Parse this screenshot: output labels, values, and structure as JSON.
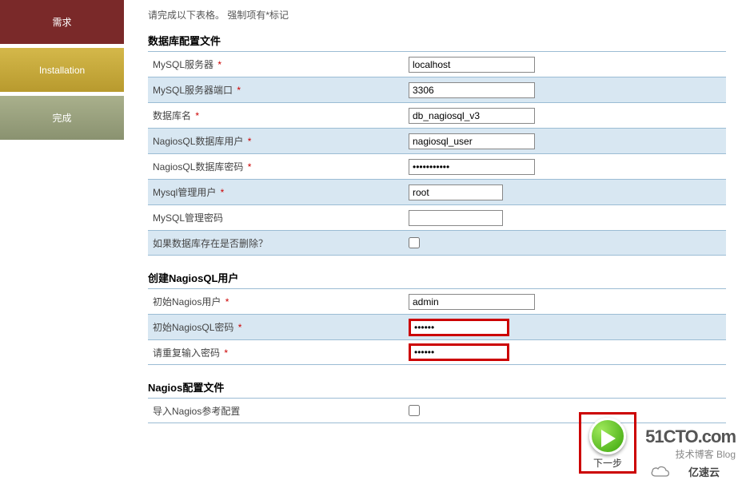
{
  "sidebar": {
    "req": "需求",
    "install": "Installation",
    "done": "完成"
  },
  "intro": "请完成以下表格。 强制项有*标记",
  "sections": {
    "db": {
      "title": "数据库配置文件",
      "mysql_server": {
        "label": "MySQL服务器",
        "value": "localhost"
      },
      "mysql_port": {
        "label": "MySQL服务器端口",
        "value": "3306"
      },
      "db_name": {
        "label": "数据库名",
        "value": "db_nagiosql_v3"
      },
      "db_user": {
        "label": "NagiosQL数据库用户",
        "value": "nagiosql_user"
      },
      "db_pass": {
        "label": "NagiosQL数据库密码",
        "value": "•••••••••••"
      },
      "admin_user": {
        "label": "Mysql管理用户",
        "value": "root"
      },
      "admin_pass": {
        "label": "MySQL管理密码",
        "value": ""
      },
      "drop_db": {
        "label": "如果数据库存在是否删除？"
      }
    },
    "user": {
      "title": "创建NagiosQL用户",
      "init_user": {
        "label": "初始Nagios用户",
        "value": "admin"
      },
      "init_pass": {
        "label": "初始NagiosQL密码",
        "value": "••••••"
      },
      "confirm_pass": {
        "label": "请重复输入密码",
        "value": "••••••"
      }
    },
    "nagios": {
      "title": "Nagios配置文件",
      "import": {
        "label": "导入Nagios参考配置"
      }
    }
  },
  "next_label": "下一步",
  "watermark": {
    "big": "51CTO.com",
    "small": "技术博客  Blog"
  },
  "yisu": "亿速云"
}
